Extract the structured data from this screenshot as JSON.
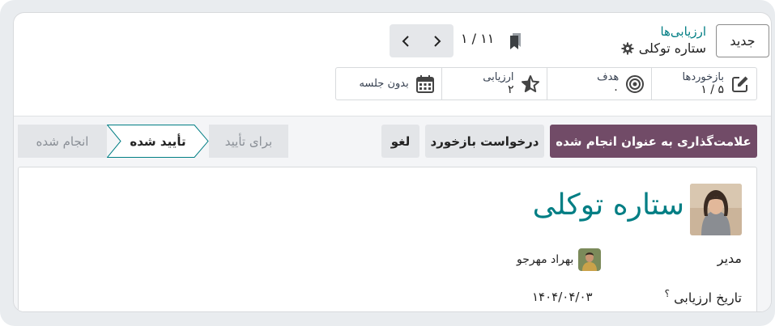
{
  "control_panel": {
    "new_button": "جدید",
    "breadcrumb_parent": "ارزیابی‌ها",
    "record_title": "ستاره توکلی",
    "pager_value": "۱ / ۱۱"
  },
  "stats": {
    "feedback_label": "بازخوردها",
    "feedback_value": "۵ / ۱",
    "goals_label": "هدف",
    "goals_value": "۰",
    "appraisal_label": "ارزیابی",
    "appraisal_value": "۲",
    "meeting_label": "بدون جلسه"
  },
  "actions": {
    "mark_done": "علامت‌گذاری به عنوان انجام شده",
    "request_feedback": "درخواست بازخورد",
    "cancel": "لغو"
  },
  "status": {
    "pending": "برای تأیید",
    "current": "تأیید شده",
    "done": "انجام شده"
  },
  "form": {
    "employee_name": "ستاره توکلی",
    "manager_label": "مدیر",
    "manager_name": "بهراد مهرجو",
    "date_label": "تاریخ ارزیابی",
    "date_help": "؟",
    "date_value": "۱۴۰۴/۰۴/۰۳"
  },
  "colors": {
    "primary": "#714b67",
    "link": "#017e84",
    "status_border": "#017e84"
  }
}
